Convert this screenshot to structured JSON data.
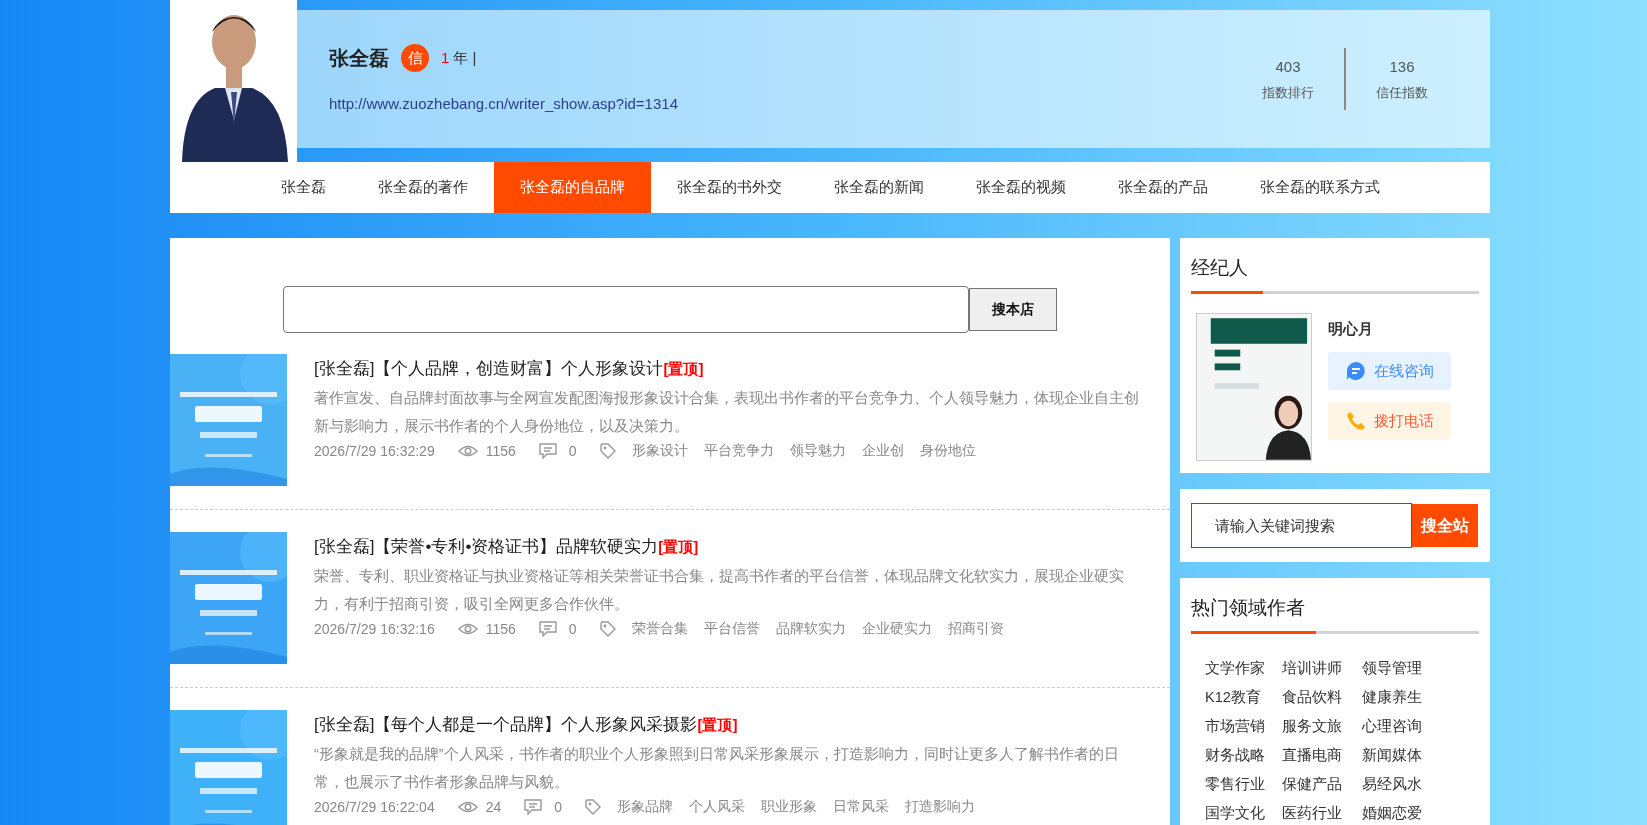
{
  "profile": {
    "name": "张全磊",
    "badge": "信",
    "years": "1",
    "years_unit": "年 |",
    "url": "http://www.zuozhebang.cn/writer_show.asp?id=1314",
    "stats": [
      {
        "value": "403",
        "label": "指数排行"
      },
      {
        "value": "136",
        "label": "信任指数"
      }
    ]
  },
  "nav": [
    {
      "label": "张全磊",
      "selected": false
    },
    {
      "label": "张全磊的著作",
      "selected": false
    },
    {
      "label": "张全磊的自品牌",
      "selected": true
    },
    {
      "label": "张全磊的书外交",
      "selected": false
    },
    {
      "label": "张全磊的新闻",
      "selected": false
    },
    {
      "label": "张全磊的视频",
      "selected": false
    },
    {
      "label": "张全磊的产品",
      "selected": false
    },
    {
      "label": "张全磊的联系方式",
      "selected": false
    }
  ],
  "store_search": {
    "button": "搜本店"
  },
  "articles": [
    {
      "title": "[张全磊]【个人品牌，创造财富】个人形象设计",
      "pin": "[置顶]",
      "desc": "著作宣发、自品牌封面故事与全网宣发配图海报形象设计合集，表现出书作者的平台竞争力、个人领导魅力，体现企业自主创新与影响力，展示书作者的个人身份地位，以及决策力。",
      "date": "2026/7/29 16:32:29",
      "views": "1156",
      "comments": "0",
      "tags": [
        "形象设计",
        "平台竞争力",
        "领导魅力",
        "企业创",
        "身份地位"
      ]
    },
    {
      "title": "[张全磊]【荣誉•专利•资格证书】品牌软硬实力",
      "pin": "[置顶]",
      "desc": "荣誉、专利、职业资格证与执业资格证等相关荣誉证书合集，提高书作者的平台信誉，体现品牌文化软实力，展现企业硬实力，有利于招商引资，吸引全网更多合作伙伴。",
      "date": "2026/7/29 16:32:16",
      "views": "1156",
      "comments": "0",
      "tags": [
        "荣誉合集",
        "平台信誉",
        "品牌软实力",
        "企业硬实力",
        "招商引资"
      ]
    },
    {
      "title": "[张全磊]【每个人都是一个品牌】个人形象风采摄影",
      "pin": "[置顶]",
      "desc": "“形象就是我的品牌”个人风采，书作者的职业个人形象照到日常风采形象展示，打造影响力，同时让更多人了解书作者的日常，也展示了书作者形象品牌与风貌。",
      "date": "2026/7/29 16:22:04",
      "views": "24",
      "comments": "0",
      "tags": [
        "形象品牌",
        "个人风采",
        "职业形象",
        "日常风采",
        "打造影响力"
      ]
    }
  ],
  "agent": {
    "heading": "经纪人",
    "name": "明心月",
    "buttons": [
      {
        "kind": "chat",
        "label": "在线咨询"
      },
      {
        "kind": "phone",
        "label": "拨打电话"
      }
    ]
  },
  "site_search": {
    "placeholder": "请输入关键词搜索",
    "button": "搜全站"
  },
  "authors": {
    "heading": "热门领域作者",
    "tags": [
      "文学作家",
      "培训讲师",
      "领导管理",
      "K12教育",
      "食品饮料",
      "健康养生",
      "市场营销",
      "服务文旅",
      "心理咨询",
      "财务战略",
      "直播电商",
      "新闻媒体",
      "零售行业",
      "保健产品",
      "易经风水",
      "国学文化",
      "医药行业",
      "婚姻恋爱"
    ]
  }
}
